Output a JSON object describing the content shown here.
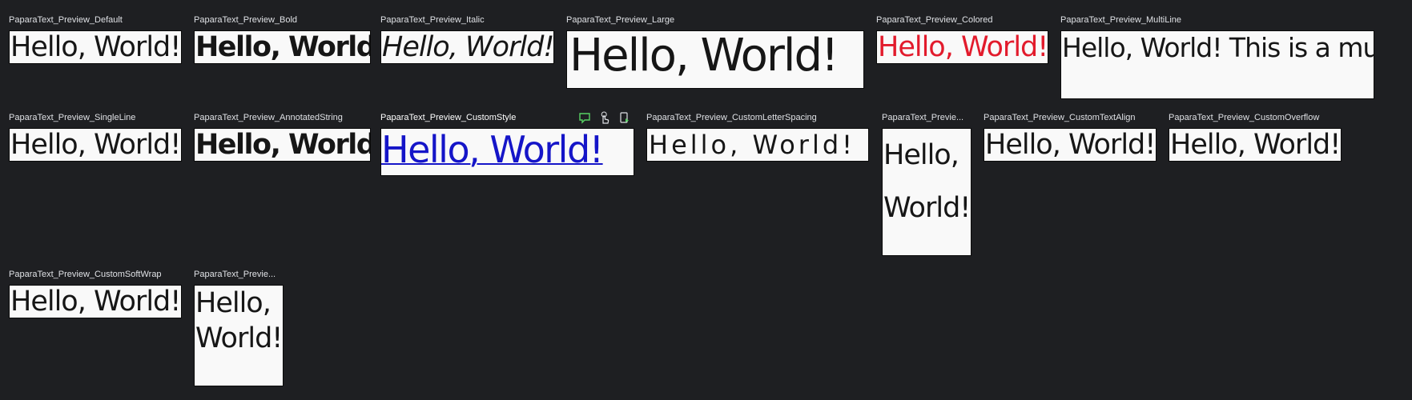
{
  "previews": [
    {
      "label": "PaparaText_Preview_Default",
      "text": "Hello, World!"
    },
    {
      "label": "PaparaText_Preview_Bold",
      "text": "Hello, World!"
    },
    {
      "label": "PaparaText_Preview_Italic",
      "text": "Hello, World!"
    },
    {
      "label": "PaparaText_Preview_Large",
      "text": "Hello, World!"
    },
    {
      "label": "PaparaText_Preview_Colored",
      "text": "Hello, World!"
    },
    {
      "label": "PaparaText_Preview_MultiLine",
      "text": "Hello, World!\nThis is a multi-line text."
    },
    {
      "label": "PaparaText_Preview_SingleLine",
      "text": "Hello, World!"
    },
    {
      "label": "PaparaText_Preview_AnnotatedString",
      "text": "Hello, World!"
    },
    {
      "label": "PaparaText_Preview_CustomStyle",
      "text": "Hello, World!"
    },
    {
      "label": "PaparaText_Preview_CustomLetterSpacing",
      "text": "Hello, World!"
    },
    {
      "label": "PaparaText_Previe...",
      "text": "Hello, World!"
    },
    {
      "label": "PaparaText_Preview_CustomTextAlign",
      "text": "Hello, World!"
    },
    {
      "label": "PaparaText_Preview_CustomOverflow",
      "text": "Hello, World!"
    },
    {
      "label": "PaparaText_Preview_CustomSoftWrap",
      "text": "Hello, World!"
    },
    {
      "label": "PaparaText_Previe...",
      "text": "Hello, World!"
    }
  ],
  "toolbar_icons": [
    "comment-icon",
    "interactive-mode-icon",
    "deploy-preview-icon"
  ],
  "colors": {
    "canvas": "#1e1f22",
    "card": "#f9f9f9",
    "text": "#161616",
    "colored_text": "#e21b2c",
    "custom_style_text": "#1515c8",
    "label": "#dfe1e5",
    "toolbar_icon": "#57d163"
  }
}
